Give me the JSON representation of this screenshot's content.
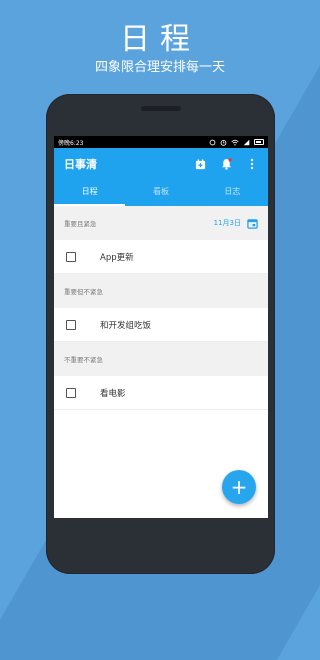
{
  "promo": {
    "title": "日程",
    "subtitle": "四象限合理安排每一天"
  },
  "status_bar": {
    "time": "傍晚6:23"
  },
  "app_bar": {
    "title": "日事清",
    "accent_color": "#1fa3ee",
    "icons": [
      "add-calendar-icon",
      "bell-icon",
      "more-vert-icon"
    ]
  },
  "tabs": [
    {
      "label": "日程",
      "active": true
    },
    {
      "label": "看板",
      "active": false
    },
    {
      "label": "日志",
      "active": false
    }
  ],
  "sections": [
    {
      "header": "重要且紧急",
      "date": "11月3日",
      "tasks": [
        {
          "label": "App更新",
          "checked": false
        }
      ]
    },
    {
      "header": "重要但不紧急",
      "tasks": [
        {
          "label": "和开发组吃饭",
          "checked": false
        }
      ]
    },
    {
      "header": "不重要不紧急",
      "tasks": [
        {
          "label": "看电影",
          "checked": false
        }
      ]
    }
  ],
  "fab": {
    "symbol": "+"
  }
}
